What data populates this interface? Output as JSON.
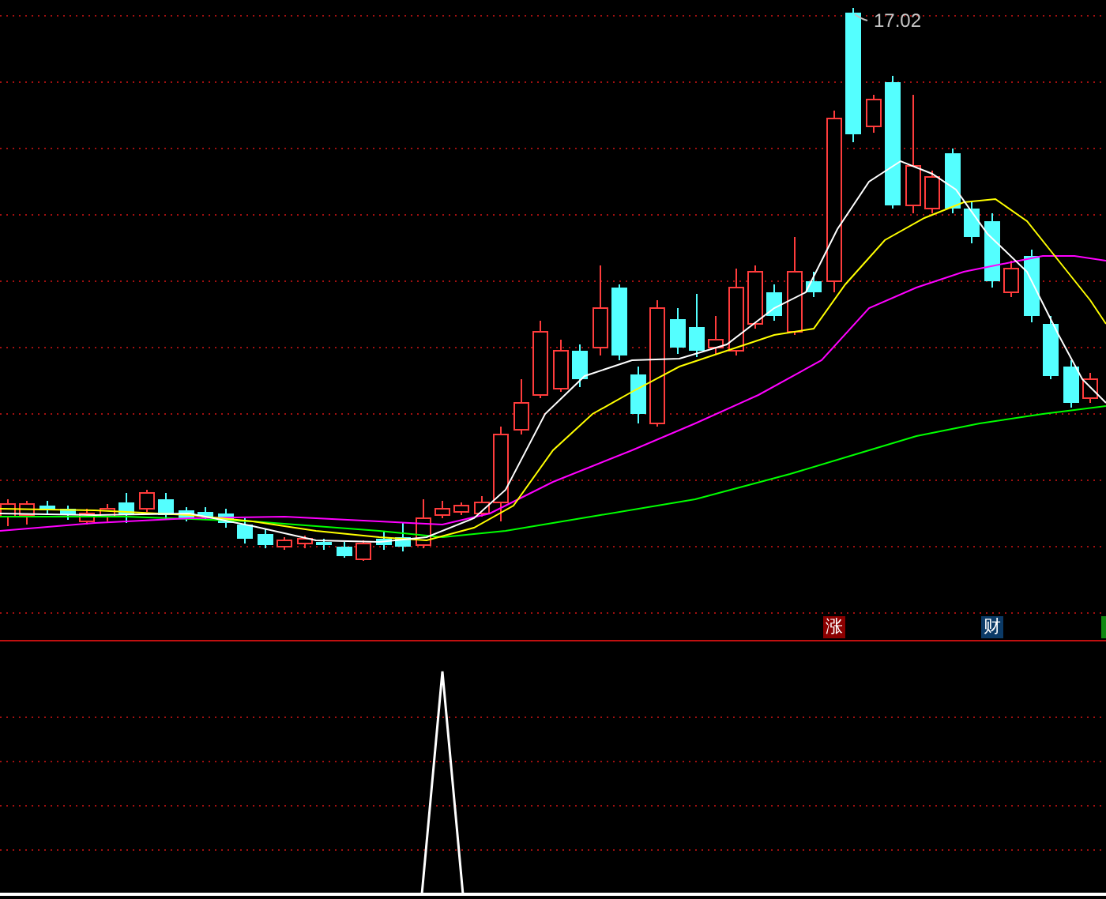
{
  "price_chart": {
    "high_label": "17.02"
  },
  "markers": [
    {
      "kind": "label",
      "text": "涨",
      "color": "#8b0000"
    },
    {
      "kind": "label",
      "text": "财",
      "color": "#0b3a66"
    },
    {
      "kind": "edge",
      "color": "#118811"
    }
  ]
}
